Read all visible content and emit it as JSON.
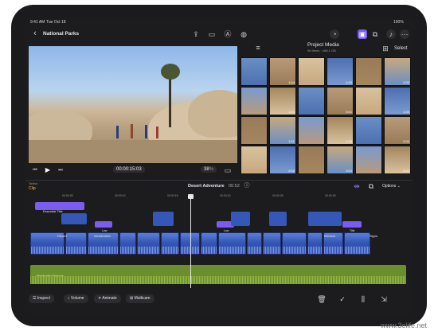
{
  "status": {
    "time": "9:41 AM",
    "date": "Tue Oct 18",
    "battery": "100%"
  },
  "header": {
    "title": "National Parks"
  },
  "media": {
    "title": "Project Media",
    "subtitle": "96 Items · 488.1 GB",
    "select_label": "Select",
    "durations": [
      "1:04",
      "1:03",
      "2:00",
      "1:03",
      "3:01",
      "1:00",
      "1:01",
      "1:05",
      "2:00",
      "2:02",
      "3:04",
      "3:02",
      "2:00",
      "2:02",
      "1:03",
      "3:14",
      "2:05",
      "1:04"
    ]
  },
  "transport": {
    "timecode_start": "00:00:",
    "timecode_end": "15:03",
    "zoom": "38",
    "zoom_unit": "%"
  },
  "inspector": {
    "select_label": "Select",
    "clip_label": "Clip"
  },
  "timeline": {
    "project_name": "Desert Adventure",
    "duration": "00:52",
    "options_label": "Options",
    "ruler": [
      "00:00:05",
      "00:00:10",
      "00:00:15",
      "00:00:20",
      "00:00:25",
      "00:00:30"
    ],
    "title_clip": "Essential Title",
    "clip_labels": [
      "Desert",
      "Introduction",
      "Medium",
      "Signs"
    ],
    "connected_labels": [
      "Low",
      "Low",
      "Title"
    ],
    "audio_label": "Practically Famous"
  },
  "toolbar": {
    "inspect": "Inspect",
    "volume": "Volume",
    "animate": "Animate",
    "multicam": "Multicam"
  },
  "watermark": "www.3elife.net",
  "colors": {
    "accent": "#7b5cf0",
    "video_clip": "#3557b8",
    "audio_clip": "#6b8f2e",
    "playhead": "#e6e6e6"
  }
}
